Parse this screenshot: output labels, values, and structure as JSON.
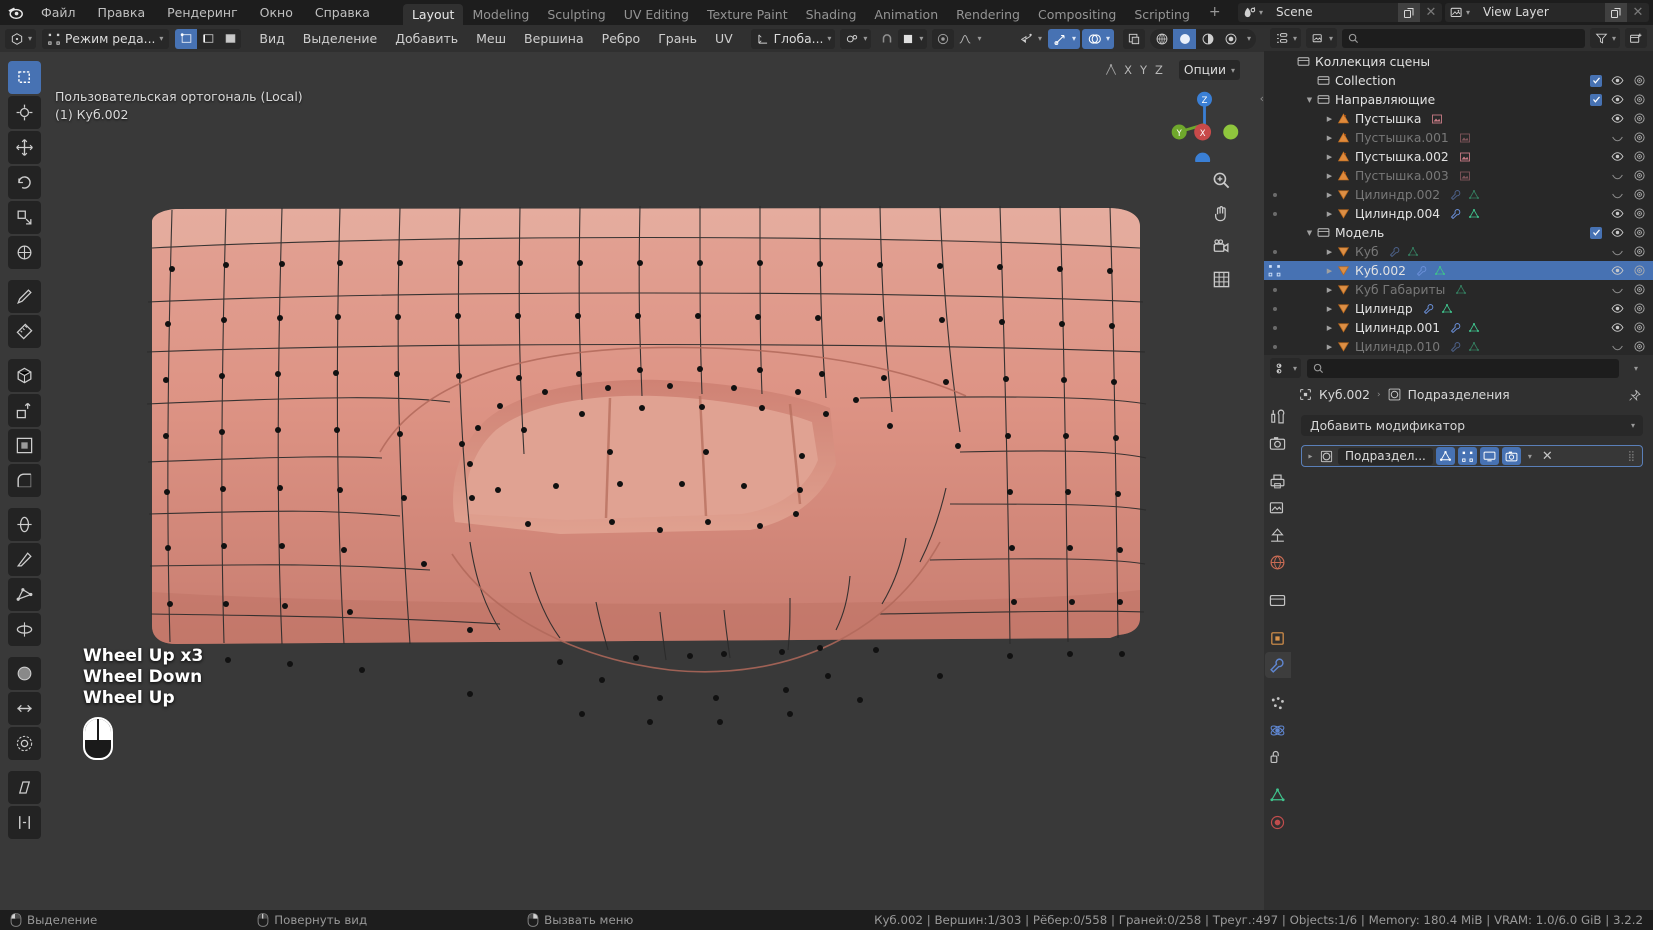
{
  "app": {
    "logo_icon": "blender-logo",
    "menus": [
      "Файл",
      "Правка",
      "Рендеринг",
      "Окно",
      "Справка"
    ],
    "workspace_tabs": [
      {
        "label": "Layout",
        "active": true
      },
      {
        "label": "Modeling",
        "active": false
      },
      {
        "label": "Sculpting",
        "active": false
      },
      {
        "label": "UV Editing",
        "active": false
      },
      {
        "label": "Texture Paint",
        "active": false
      },
      {
        "label": "Shading",
        "active": false
      },
      {
        "label": "Animation",
        "active": false
      },
      {
        "label": "Rendering",
        "active": false
      },
      {
        "label": "Compositing",
        "active": false
      },
      {
        "label": "Scripting",
        "active": false
      }
    ],
    "add_workspace_label": "+",
    "scene": {
      "icon": "scene-icon",
      "name": "Scene",
      "new_icon": "duplicate-icon",
      "unlink_icon": "close-icon"
    },
    "view_layer": {
      "icon": "view-layer-icon",
      "name": "View Layer",
      "new_icon": "duplicate-icon",
      "unlink_icon": "close-icon"
    }
  },
  "viewport_header": {
    "editor_type_icon": "editor-type-icon",
    "mode_icon": "edit-mode-icon",
    "mode_label": "Режим реда...",
    "select_modes": [
      {
        "icon": "vertex-select-icon",
        "active": true
      },
      {
        "icon": "edge-select-icon",
        "active": false
      },
      {
        "icon": "face-select-icon",
        "active": false
      }
    ],
    "menus": [
      "Вид",
      "Выделение",
      "Добавить",
      "Меш",
      "Вершина",
      "Ребро",
      "Грань",
      "UV"
    ],
    "transform_orientation": {
      "icon": "orientation-icon",
      "label": "Глоба..."
    },
    "pivot": {
      "icon": "pivot-icon"
    },
    "snap": {
      "icon": "magnet-icon",
      "active": false
    },
    "snap_target": {
      "icon": "snap-increment-icon"
    },
    "proportional": {
      "icon": "proportional-edit-icon",
      "active": false
    },
    "proportional_falloff": {
      "icon": "falloff-curve-icon"
    },
    "visibility": {
      "icon": "object-types-visibility-icon"
    },
    "gizmo": {
      "icon": "gizmo-icon",
      "active": true
    },
    "overlays": {
      "icon": "overlays-icon",
      "active": true
    },
    "xray": {
      "icon": "xray-icon",
      "active": false
    },
    "shading_modes": [
      {
        "icon": "wireframe-shading-icon",
        "active": false
      },
      {
        "icon": "solid-shading-icon",
        "active": true
      },
      {
        "icon": "material-preview-icon",
        "active": false
      },
      {
        "icon": "rendered-shading-icon",
        "active": false
      }
    ]
  },
  "viewport": {
    "toolbar": [
      {
        "icon": "tweak-select-box-icon",
        "active": true
      },
      {
        "icon": "cursor-3d-icon",
        "active": false
      },
      {
        "icon": "move-icon",
        "active": false
      },
      {
        "icon": "rotate-icon",
        "active": false
      },
      {
        "icon": "scale-icon",
        "active": false
      },
      {
        "icon": "transform-icon",
        "active": false
      },
      {
        "icon": "annotate-icon",
        "active": false
      },
      {
        "icon": "measure-icon",
        "active": false
      },
      {
        "icon": "add-cube-icon",
        "active": false
      },
      {
        "icon": "extrude-region-icon",
        "active": false
      },
      {
        "icon": "inset-faces-icon",
        "active": false
      },
      {
        "icon": "bevel-icon",
        "active": false
      },
      {
        "icon": "loop-cut-icon",
        "active": false
      },
      {
        "icon": "knife-icon",
        "active": false
      },
      {
        "icon": "poly-build-icon",
        "active": false
      },
      {
        "icon": "spin-icon",
        "active": false
      },
      {
        "icon": "smooth-icon",
        "active": false
      },
      {
        "icon": "edge-slide-icon",
        "active": false
      },
      {
        "icon": "shrink-fatten-icon",
        "active": false
      },
      {
        "icon": "shear-icon",
        "active": false
      },
      {
        "icon": "rip-region-icon",
        "active": false
      }
    ],
    "overlay_text_line1": "Пользовательская ортогональ (Local)",
    "overlay_text_line2": "(1) Куб.002",
    "axis_toggles": [
      "X",
      "Y",
      "Z"
    ],
    "options_label": "Опции",
    "gizmo_axes": {
      "z": "Z",
      "x": "X",
      "y": "Y"
    },
    "nav_icons": [
      "zoom-icon",
      "pan-hand-icon",
      "camera-view-icon",
      "ortho-persp-grid-icon"
    ],
    "sidebar_arrow_icon": "chevron-left-icon",
    "wheel_overlay": [
      "Wheel Up x3",
      "Wheel Down",
      "Wheel Up"
    ],
    "mouse_icon": "mouse-wheel-icon",
    "mesh_color": "#d9897e"
  },
  "outliner": {
    "display_mode_icon": "outliner-display-mode-icon",
    "filter_id_icon": "filter-id-icon",
    "search_icon": "search-icon",
    "search_value": "",
    "filter_icon": "funnel-icon",
    "new_collection_icon": "new-collection-icon",
    "rows": [
      {
        "indent": 0,
        "icon": "collection-icon",
        "label": "Коллекция сцены",
        "dim": false,
        "disclosure": "",
        "checkbox": false,
        "eye": false,
        "camera": false,
        "dot": false,
        "tags": []
      },
      {
        "indent": 1,
        "icon": "collection-icon",
        "label": "Collection",
        "dim": false,
        "disclosure": "",
        "checkbox": true,
        "eye": "open",
        "camera": true,
        "dot": false,
        "tags": []
      },
      {
        "indent": 1,
        "icon": "collection-icon",
        "label": "Направляющие",
        "dim": false,
        "disclosure": "down",
        "checkbox": true,
        "eye": "open",
        "camera": true,
        "dot": false,
        "tags": []
      },
      {
        "indent": 2,
        "icon": "empty-axes-icon",
        "label": "Пустышка",
        "dim": false,
        "disclosure": "right",
        "checkbox": false,
        "eye": "open",
        "camera": true,
        "dot": false,
        "tags": [
          "empty-image-icon"
        ]
      },
      {
        "indent": 2,
        "icon": "empty-axes-icon",
        "label": "Пустышка.001",
        "dim": true,
        "disclosure": "right",
        "checkbox": false,
        "eye": "closed",
        "camera": true,
        "dot": false,
        "tags": [
          "empty-image-icon"
        ]
      },
      {
        "indent": 2,
        "icon": "empty-axes-icon",
        "label": "Пустышка.002",
        "dim": false,
        "disclosure": "right",
        "checkbox": false,
        "eye": "open",
        "camera": true,
        "dot": false,
        "tags": [
          "empty-image-icon"
        ]
      },
      {
        "indent": 2,
        "icon": "empty-axes-icon",
        "label": "Пустышка.003",
        "dim": true,
        "disclosure": "right",
        "checkbox": false,
        "eye": "closed",
        "camera": true,
        "dot": false,
        "tags": [
          "empty-image-icon"
        ]
      },
      {
        "indent": 2,
        "icon": "mesh-object-icon",
        "label": "Цилиндр.002",
        "dim": true,
        "disclosure": "right",
        "checkbox": false,
        "eye": "closed",
        "camera": true,
        "dot": true,
        "tags": [
          "modifier-icon",
          "mesh-data-icon"
        ]
      },
      {
        "indent": 2,
        "icon": "mesh-object-icon",
        "label": "Цилиндр.004",
        "dim": false,
        "disclosure": "right",
        "checkbox": false,
        "eye": "open",
        "camera": true,
        "dot": true,
        "tags": [
          "modifier-icon",
          "mesh-data-icon"
        ]
      },
      {
        "indent": 1,
        "icon": "collection-icon",
        "label": "Модель",
        "dim": false,
        "disclosure": "down",
        "checkbox": true,
        "eye": "open",
        "camera": true,
        "dot": false,
        "tags": []
      },
      {
        "indent": 2,
        "icon": "mesh-object-icon",
        "label": "Куб",
        "dim": true,
        "disclosure": "right",
        "checkbox": false,
        "eye": "closed",
        "camera": true,
        "dot": true,
        "tags": [
          "modifier-icon",
          "mesh-data-icon"
        ]
      },
      {
        "indent": 2,
        "icon": "mesh-object-icon",
        "label": "Куб.002",
        "dim": false,
        "disclosure": "right",
        "checkbox": false,
        "eye": "open",
        "camera": true,
        "dot": false,
        "selected": true,
        "edit": true,
        "tags": [
          "modifier-icon",
          "mesh-data-icon"
        ]
      },
      {
        "indent": 2,
        "icon": "mesh-object-icon",
        "label": "Куб Габариты",
        "dim": true,
        "disclosure": "right",
        "checkbox": false,
        "eye": "closed",
        "camera": true,
        "dot": true,
        "tags": [
          "mesh-data-icon"
        ]
      },
      {
        "indent": 2,
        "icon": "mesh-object-icon",
        "label": "Цилиндр",
        "dim": false,
        "disclosure": "right",
        "checkbox": false,
        "eye": "open",
        "camera": true,
        "dot": true,
        "tags": [
          "modifier-icon",
          "mesh-data-icon"
        ]
      },
      {
        "indent": 2,
        "icon": "mesh-object-icon",
        "label": "Цилиндр.001",
        "dim": false,
        "disclosure": "right",
        "checkbox": false,
        "eye": "open",
        "camera": true,
        "dot": true,
        "tags": [
          "modifier-icon",
          "mesh-data-icon"
        ]
      },
      {
        "indent": 2,
        "icon": "mesh-object-icon",
        "label": "Цилиндр.010",
        "dim": true,
        "disclosure": "right",
        "checkbox": false,
        "eye": "closed",
        "camera": true,
        "dot": true,
        "tags": [
          "modifier-icon",
          "mesh-data-icon"
        ]
      }
    ]
  },
  "properties": {
    "editor_icon": "properties-editor-icon",
    "search_icon": "search-icon",
    "search_value": "",
    "collapse_icon": "chevron-down-icon",
    "tabs": [
      {
        "icon": "tool-icon",
        "active": false
      },
      {
        "icon": "render-icon",
        "active": false
      },
      {
        "icon": "output-icon",
        "active": false
      },
      {
        "icon": "view-layer-props-icon",
        "active": false
      },
      {
        "icon": "scene-props-icon",
        "active": false
      },
      {
        "icon": "world-props-icon",
        "active": false
      },
      {
        "icon": "collection-props-icon",
        "active": false
      },
      {
        "icon": "object-props-icon",
        "active": false
      },
      {
        "icon": "modifier-props-icon",
        "active": true
      },
      {
        "icon": "particles-props-icon",
        "active": false
      },
      {
        "icon": "physics-props-icon",
        "active": false
      },
      {
        "icon": "constraints-props-icon",
        "active": false
      },
      {
        "icon": "object-data-props-icon",
        "active": false
      },
      {
        "icon": "material-props-icon",
        "active": false
      }
    ],
    "breadcrumb": {
      "object_icon": "object-icon",
      "object_name": "Куб.002",
      "separator": "›",
      "modifier_icon": "modifier-icon",
      "modifier_name": "Подразделения",
      "pin_icon": "pin-icon"
    },
    "add_modifier_label": "Добавить модификатор",
    "add_modifier_chevron": "chevron-down-icon",
    "modifier": {
      "expand_icon": "chevron-right-icon",
      "type_icon": "subsurf-icon",
      "name": "Подраздел...",
      "toggles": [
        {
          "icon": "on-cage-icon",
          "active": true
        },
        {
          "icon": "edit-mode-display-icon",
          "active": true
        },
        {
          "icon": "realtime-display-icon",
          "active": true
        },
        {
          "icon": "render-display-icon",
          "active": true
        }
      ],
      "dropdown_icon": "chevron-down-icon",
      "close_icon": "close-icon",
      "drag_icon": "drag-dots-icon"
    }
  },
  "statusbar": {
    "hints": [
      {
        "icon": "mouse-left-icon",
        "label": "Выделение"
      },
      {
        "icon": "mouse-middle-icon",
        "label": "Повернуть вид"
      },
      {
        "icon": "mouse-right-icon",
        "label": "Вызвать меню"
      }
    ],
    "stats": "Куб.002 | Вершин:1/303 | Рёбер:0/558 | Граней:0/258 | Треуг.:497 | Objects:1/6 | Memory: 180.4 MiB | VRAM: 1.0/6.0 GiB | 3.2.2"
  }
}
